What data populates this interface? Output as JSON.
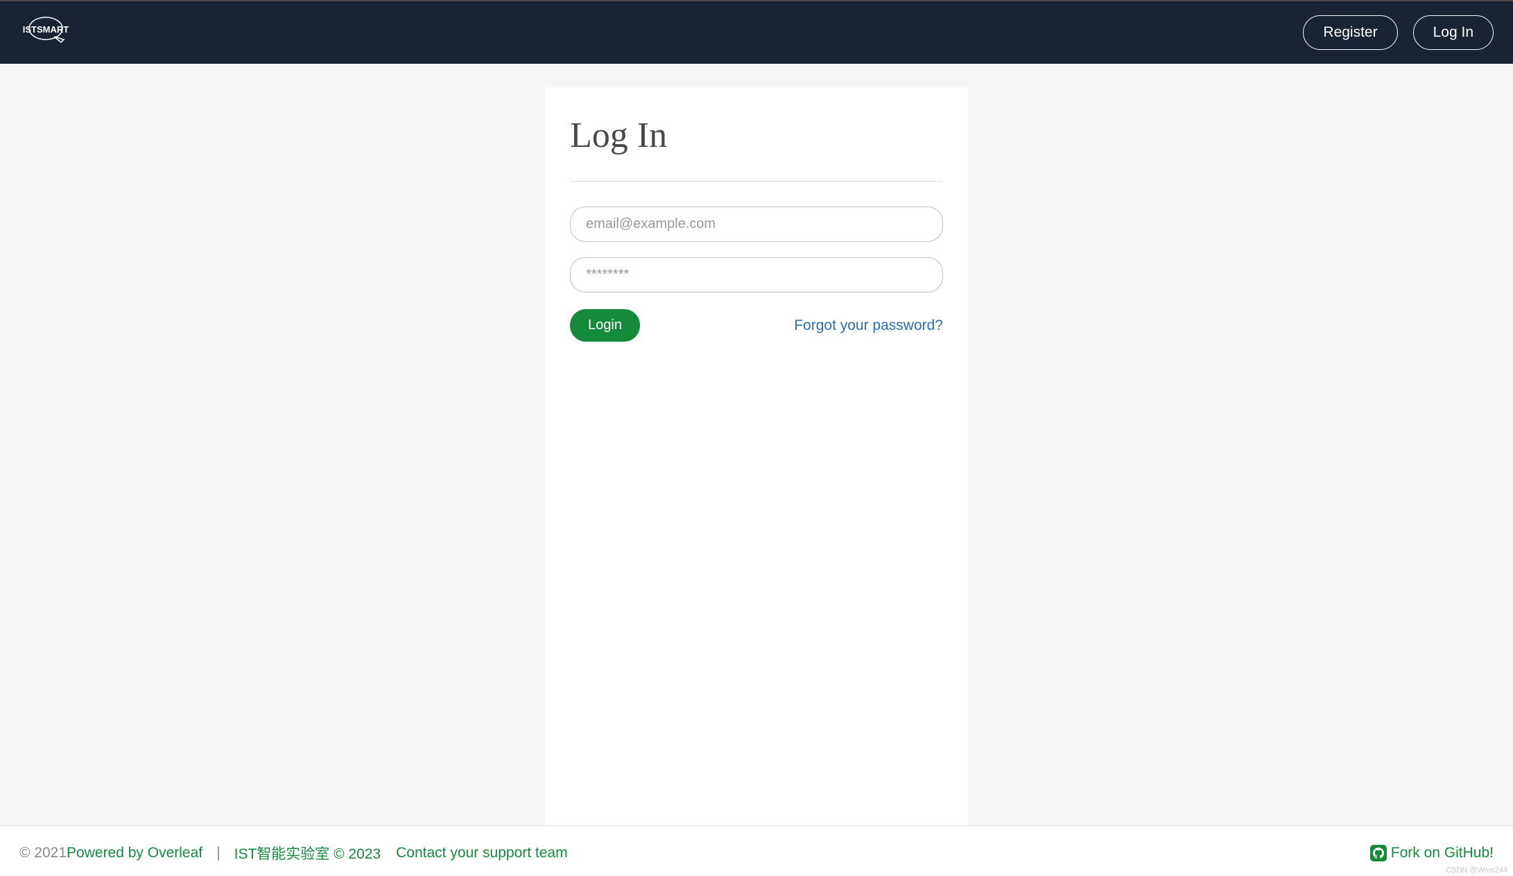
{
  "header": {
    "logo_text": "ISTSMART",
    "register_label": "Register",
    "login_label": "Log In"
  },
  "login_form": {
    "title": "Log In",
    "email_placeholder": "email@example.com",
    "password_placeholder": "********",
    "login_button": "Login",
    "forgot_password": "Forgot your password?"
  },
  "footer": {
    "copyright_prefix": "© 2021 ",
    "powered_by": "Powered by Overleaf",
    "separator": "|",
    "lab_info": "IST智能实验室 © 2023",
    "support": "Contact your support team",
    "fork_github": "Fork on GitHub!"
  },
  "watermark": "CSDN @Wms244"
}
